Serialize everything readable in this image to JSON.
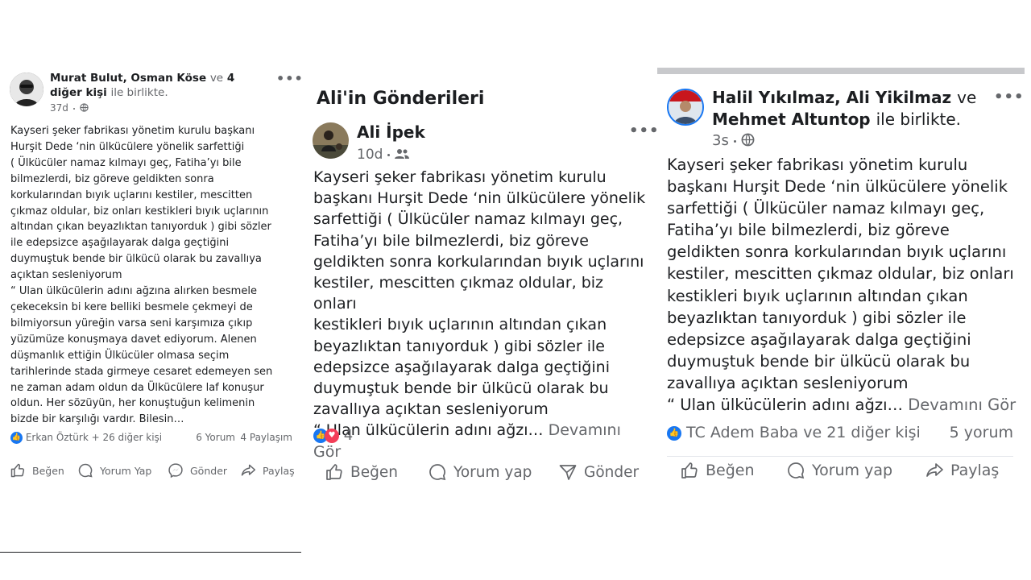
{
  "posts": [
    {
      "author1": "Murat Bulut",
      "comma": ",",
      "author2": "Osman Köse",
      "and": "ve",
      "others": "4 diğer kişi",
      "with": "ile birlikte.",
      "time": "37d",
      "body": [
        "Kayseri şeker fabrikası yönetim kurulu başkanı",
        "Hurşit Dede ‘nin ülkücülere yönelik sarfettiği",
        "( Ülkücüler namaz kılmayı geç, Fatiha’yı bile",
        "bilmezlerdi, biz göreve geldikten sonra",
        "korkularından bıyık uçlarını kestiler, mescitten",
        "çıkmaz oldular, biz onları kestikleri bıyık uçlarının",
        "altından çıkan  beyazlıktan tanıyorduk ) gibi sözler",
        "ile edepsizce aşağılayarak dalga geçtiğini",
        "duymuştuk bende bir ülkücü olarak bu zavallıya",
        "açıktan sesleniyorum",
        "“ Ulan ülkücülerin adını ağzına alırken besmele",
        "çekeceksin bi kere belliki besmele çekmeyi de",
        "bilmiyorsun yüreğin varsa seni karşımıza çıkıp",
        "yüzümüze konuşmaya davet ediyorum. Alenen",
        "düşmanlık ettiğin Ülkücüler olmasa seçim",
        "tarihlerinde stada girmeye cesaret edemeyen sen",
        "ne zaman adam oldun da Ülkücülere laf konuşur",
        "oldun. Her sözüyün, her konuştuğun kelimenin",
        "bizde bir karşılığı vardır. Bilesin…"
      ],
      "reactions": "Erkan Öztürk + 26 diğer kişi",
      "comments": "6 Yorum",
      "shares": "4 Paylaşım",
      "actions": {
        "like": "Beğen",
        "comment": "Yorum Yap",
        "send": "Gönder",
        "share": "Paylaş"
      }
    },
    {
      "section_title": "Ali'in Gönderileri",
      "author": "Ali İpek",
      "time": "10d",
      "body": [
        "Kayseri şeker fabrikası yönetim kurulu",
        "başkanı Hurşit Dede ‘nin ülkücülere yönelik",
        "sarfettiği ( Ülkücüler namaz kılmayı geç,",
        "Fatiha’yı bile bilmezlerdi, biz göreve",
        "geldikten sonra korkularından bıyık uçlarını",
        "kestiler, mescitten çıkmaz oldular, biz onları",
        "kestikleri bıyık uçlarının altından çıkan",
        "beyazlıktan tanıyorduk ) gibi sözler ile",
        "edepsizce aşağılayarak dalga geçtiğini",
        "duymuştuk bende bir ülkücü olarak bu",
        "zavallıya açıktan sesleniyorum"
      ],
      "last_line": "“ Ulan ülkücülerin adını ağzı…",
      "see_more": "Devamını Gör",
      "reaction_count": "4",
      "actions": {
        "like": "Beğen",
        "comment": "Yorum yap",
        "send": "Gönder"
      }
    },
    {
      "author1": "Halil Yıkılmaz",
      "comma": ",",
      "author2": "Ali Yikilmaz",
      "and": "ve",
      "author3": "Mehmet Altuntop",
      "with": "ile birlikte.",
      "time": "3s",
      "body": [
        "Kayseri şeker fabrikası yönetim kurulu",
        "başkanı Hurşit Dede ‘nin ülkücülere yönelik",
        "sarfettiği ( Ülkücüler namaz kılmayı geç,",
        "Fatiha’yı bile bilmezlerdi, biz göreve",
        "geldikten sonra korkularından bıyık uçlarını",
        "kestiler, mescitten çıkmaz oldular, biz onları",
        "kestikleri bıyık uçlarının altından çıkan",
        "beyazlıktan tanıyorduk ) gibi sözler ile",
        "edepsizce aşağılayarak dalga geçtiğini",
        "duymuştuk bende bir ülkücü olarak bu",
        "zavallıya açıktan sesleniyorum"
      ],
      "last_line": "“ Ulan ülkücülerin adını ağzı…",
      "see_more": "Devamını Gör",
      "reactions": "TC Adem Baba ve 21 diğer kişi",
      "comments": "5 yorum",
      "actions": {
        "like": "Beğen",
        "comment": "Yorum yap",
        "share": "Paylaş"
      }
    }
  ],
  "colors": {
    "facebook_blue": "#1877f2",
    "love_red": "#f33e58",
    "secondary_text": "#65676b"
  },
  "icons": [
    "more-icon",
    "globe-icon",
    "friends-icon",
    "like-icon",
    "comment-icon",
    "messenger-icon",
    "send-icon",
    "share-icon"
  ]
}
